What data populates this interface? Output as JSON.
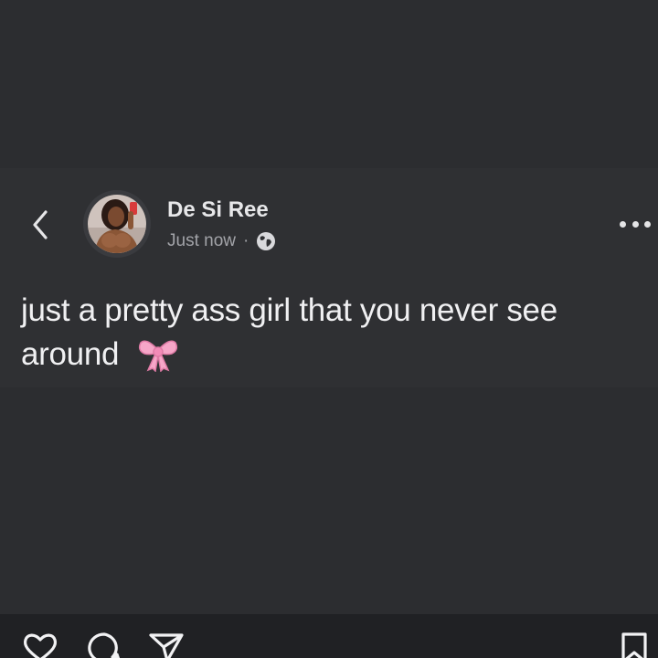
{
  "post": {
    "author": "De Si Ree",
    "timestamp": "Just now",
    "separator": "·",
    "visibility_icon": "globe-icon",
    "text": "just a pretty ass girl that you never see around",
    "emoji": "ribbon-bow-emoji"
  },
  "icons": {
    "back": "chevron-left-icon",
    "more": "more-dots-icon",
    "like": "heart-icon",
    "comment": "comment-icon",
    "share": "send-icon",
    "save": "bookmark-icon"
  },
  "colors": {
    "background": "#2c2d30",
    "card": "#2f3033",
    "text": "#f0f0f2",
    "meta": "#a2a3a8",
    "bow_pink": "#f6a6c8",
    "bottom_bar": "#202124"
  }
}
